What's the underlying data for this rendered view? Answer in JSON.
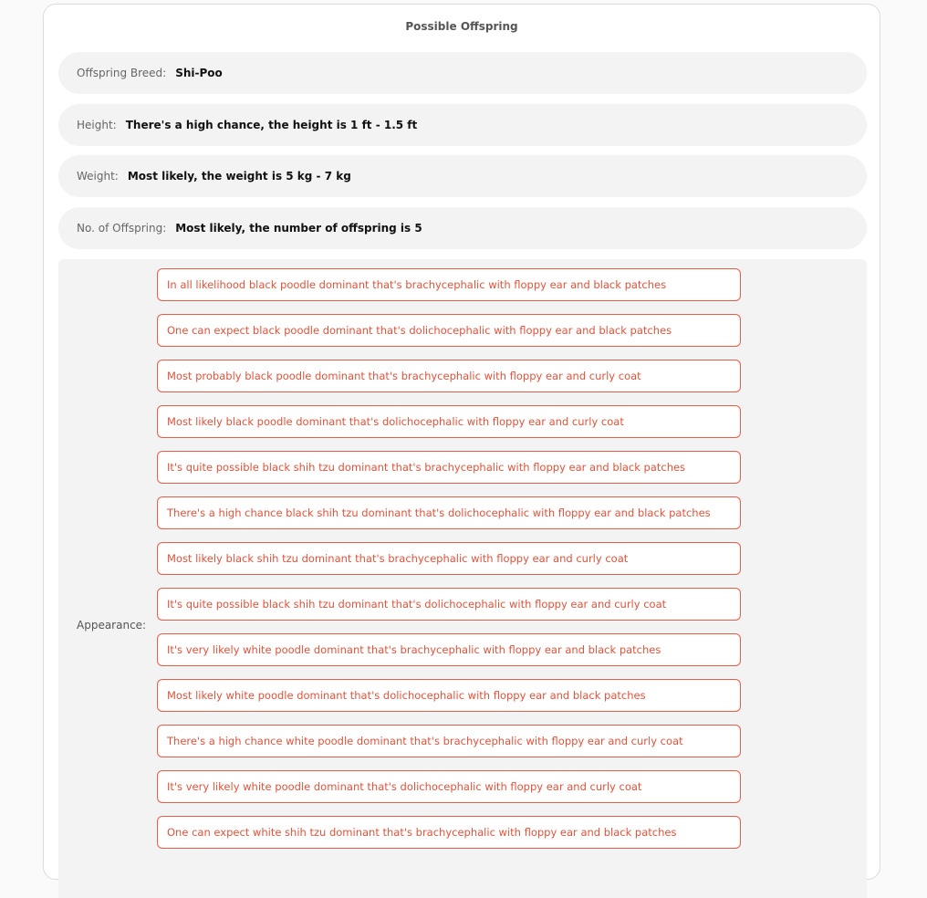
{
  "title": "Possible Offspring",
  "breed": {
    "label": "Offspring Breed:",
    "value": "Shi-Poo"
  },
  "height": {
    "label": "Height:",
    "value": "There's a high chance, the height is 1 ft - 1.5 ft"
  },
  "weight": {
    "label": "Weight:",
    "value": "Most likely, the weight is 5 kg - 7 kg"
  },
  "offspring_count": {
    "label": "No. of Offspring:",
    "value": "Most likely, the number of offspring is 5"
  },
  "appearance": {
    "label": "Appearance:",
    "options": [
      "In all likelihood black poodle dominant that's brachycephalic with floppy ear and black patches",
      "One can expect black poodle dominant that's dolichocephalic with floppy ear and black patches",
      "Most probably black poodle dominant that's brachycephalic with floppy ear and curly coat",
      "Most likely black poodle dominant that's dolichocephalic with floppy ear and curly coat",
      "It's quite possible black shih tzu dominant that's brachycephalic with floppy ear and black patches",
      "There's a high chance black shih tzu dominant that's dolichocephalic with floppy ear and black patches",
      "Most likely black shih tzu dominant that's brachycephalic with floppy ear and curly coat",
      "It's quite possible black shih tzu dominant that's dolichocephalic with floppy ear and curly coat",
      "It's very likely white poodle dominant that's brachycephalic with floppy ear and black patches",
      "Most likely white poodle dominant that's dolichocephalic with floppy ear and black patches",
      "There's a high chance white poodle dominant that's brachycephalic with floppy ear and curly coat",
      "It's very likely white poodle dominant that's dolichocephalic with floppy ear and curly coat",
      "One can expect white shih tzu dominant that's brachycephalic with floppy ear and black patches"
    ]
  },
  "colors": {
    "accent": "#e85c45",
    "row_background": "#f3f3f3"
  }
}
